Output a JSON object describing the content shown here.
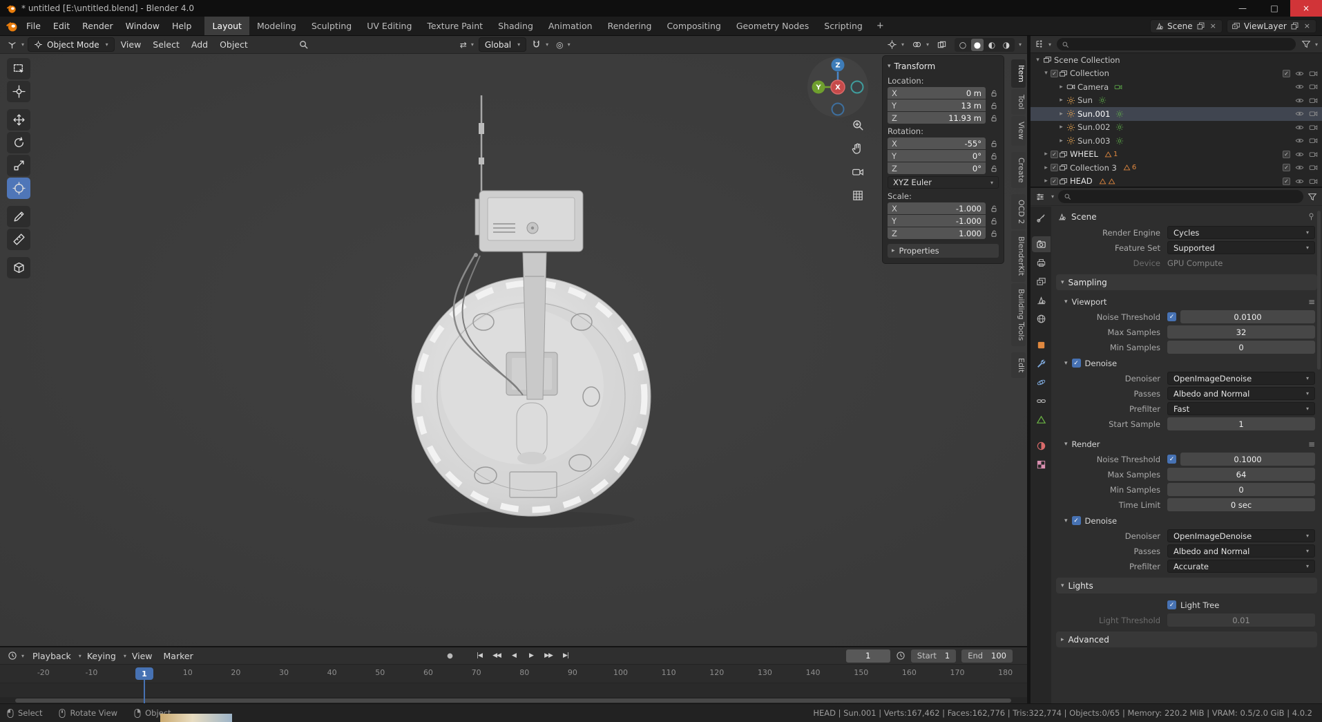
{
  "icons": {
    "chevron_down": "▾",
    "chevron_right": "▸",
    "check": "✓",
    "plus": "+",
    "minimize": "—",
    "maximize": "□",
    "close": "×",
    "menu_list": "≡",
    "wireframe": "○",
    "solid": "●",
    "material": "◐",
    "rendered": "◑",
    "proportional": "◎",
    "orientation_swap": "⇄",
    "record": "●"
  },
  "window": {
    "title": "* untitled [E:\\untitled.blend] - Blender 4.0"
  },
  "topbar": {
    "menus": [
      "File",
      "Edit",
      "Render",
      "Window",
      "Help"
    ],
    "workspaces": [
      "Layout",
      "Modeling",
      "Sculpting",
      "UV Editing",
      "Texture Paint",
      "Shading",
      "Animation",
      "Rendering",
      "Compositing",
      "Geometry Nodes",
      "Scripting"
    ],
    "scene": "Scene",
    "view_layer": "ViewLayer"
  },
  "viewport": {
    "header": {
      "mode": "Object Mode",
      "menus": [
        "View",
        "Select",
        "Add",
        "Object"
      ],
      "orientation": "Global"
    },
    "gizmo": {
      "x": "X",
      "y": "Y",
      "z": "Z"
    },
    "side_tabs": [
      "Item",
      "Tool",
      "View",
      "Create",
      "OCD 2",
      "BlenderKit",
      "Building Tools",
      "Edit"
    ],
    "npanel": {
      "title": "Transform",
      "location_label": "Location:",
      "rotation_label": "Rotation:",
      "scale_label": "Scale:",
      "euler": "XYZ Euler",
      "properties_label": "Properties",
      "location": [
        {
          "axis": "X",
          "value": "0 m"
        },
        {
          "axis": "Y",
          "value": "13 m"
        },
        {
          "axis": "Z",
          "value": "11.93 m"
        }
      ],
      "rotation": [
        {
          "axis": "X",
          "value": "-55°"
        },
        {
          "axis": "Y",
          "value": "0°"
        },
        {
          "axis": "Z",
          "value": "0°"
        }
      ],
      "scale": [
        {
          "axis": "X",
          "value": "-1.000"
        },
        {
          "axis": "Y",
          "value": "-1.000"
        },
        {
          "axis": "Z",
          "value": "1.000"
        }
      ]
    }
  },
  "outliner": {
    "rows": [
      {
        "label": "Scene Collection"
      },
      {
        "label": "Collection"
      },
      {
        "label": "Camera"
      },
      {
        "label": "Sun"
      },
      {
        "label": "Sun.001"
      },
      {
        "label": "Sun.002"
      },
      {
        "label": "Sun.003"
      },
      {
        "label": "WHEEL",
        "badge": "1"
      },
      {
        "label": "Collection 3",
        "badge": "6"
      },
      {
        "label": "HEAD"
      }
    ]
  },
  "properties": {
    "context": "Scene",
    "render_engine_label": "Render Engine",
    "render_engine": "Cycles",
    "feature_set_label": "Feature Set",
    "feature_set": "Supported",
    "device_label": "Device",
    "device": "GPU Compute",
    "sampling_title": "Sampling",
    "viewport_title": "Viewport",
    "render_title": "Render",
    "noise_threshold_label": "Noise Threshold",
    "max_samples_label": "Max Samples",
    "min_samples_label": "Min Samples",
    "denoise_label": "Denoise",
    "denoiser_label": "Denoiser",
    "passes_label": "Passes",
    "prefilter_label": "Prefilter",
    "start_sample_label": "Start Sample",
    "time_limit_label": "Time Limit",
    "viewport_values": {
      "noise_threshold": "0.0100",
      "max_samples": "32",
      "min_samples": "0",
      "denoiser": "OpenImageDenoise",
      "passes": "Albedo and Normal",
      "prefilter": "Fast",
      "start_sample": "1"
    },
    "render_values": {
      "noise_threshold": "0.1000",
      "max_samples": "64",
      "min_samples": "0",
      "time_limit": "0 sec",
      "denoiser": "OpenImageDenoise",
      "passes": "Albedo and Normal",
      "prefilter": "Accurate"
    },
    "lights_title": "Lights",
    "light_tree_label": "Light Tree",
    "light_threshold_label": "Light Threshold",
    "light_threshold": "0.01",
    "advanced_title": "Advanced"
  },
  "timeline": {
    "menus": [
      "Playback",
      "Keying",
      "View",
      "Marker"
    ],
    "transport": [
      "|◀",
      "◀◀",
      "◀",
      "▶",
      "▶▶",
      "▶|"
    ],
    "current_frame": "1",
    "start_label": "Start",
    "start": "1",
    "end_label": "End",
    "end": "100",
    "playhead": "1",
    "ticks": [
      "-20",
      "-10",
      "0",
      "10",
      "20",
      "30",
      "40",
      "50",
      "60",
      "70",
      "80",
      "90",
      "100",
      "110",
      "120",
      "130",
      "140",
      "150",
      "160",
      "170",
      "180"
    ]
  },
  "statusbar": {
    "hints": [
      "Select",
      "Rotate View",
      "Object"
    ],
    "info": "HEAD | Sun.001 | Verts:167,462 | Faces:162,776 | Tris:322,774 | Objects:0/65 | Memory: 220.2 MiB | VRAM: 0.5/2.0 GiB | 4.0.2"
  }
}
